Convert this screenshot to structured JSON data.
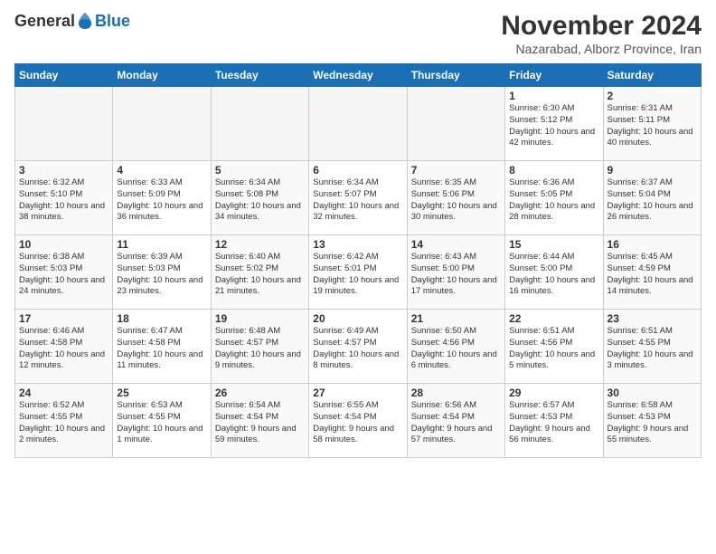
{
  "logo": {
    "general": "General",
    "blue": "Blue"
  },
  "header": {
    "month": "November 2024",
    "location": "Nazarabad, Alborz Province, Iran"
  },
  "weekdays": [
    "Sunday",
    "Monday",
    "Tuesday",
    "Wednesday",
    "Thursday",
    "Friday",
    "Saturday"
  ],
  "weeks": [
    [
      {
        "day": "",
        "detail": ""
      },
      {
        "day": "",
        "detail": ""
      },
      {
        "day": "",
        "detail": ""
      },
      {
        "day": "",
        "detail": ""
      },
      {
        "day": "",
        "detail": ""
      },
      {
        "day": "1",
        "detail": "Sunrise: 6:30 AM\nSunset: 5:12 PM\nDaylight: 10 hours\nand 42 minutes."
      },
      {
        "day": "2",
        "detail": "Sunrise: 6:31 AM\nSunset: 5:11 PM\nDaylight: 10 hours\nand 40 minutes."
      }
    ],
    [
      {
        "day": "3",
        "detail": "Sunrise: 6:32 AM\nSunset: 5:10 PM\nDaylight: 10 hours\nand 38 minutes."
      },
      {
        "day": "4",
        "detail": "Sunrise: 6:33 AM\nSunset: 5:09 PM\nDaylight: 10 hours\nand 36 minutes."
      },
      {
        "day": "5",
        "detail": "Sunrise: 6:34 AM\nSunset: 5:08 PM\nDaylight: 10 hours\nand 34 minutes."
      },
      {
        "day": "6",
        "detail": "Sunrise: 6:34 AM\nSunset: 5:07 PM\nDaylight: 10 hours\nand 32 minutes."
      },
      {
        "day": "7",
        "detail": "Sunrise: 6:35 AM\nSunset: 5:06 PM\nDaylight: 10 hours\nand 30 minutes."
      },
      {
        "day": "8",
        "detail": "Sunrise: 6:36 AM\nSunset: 5:05 PM\nDaylight: 10 hours\nand 28 minutes."
      },
      {
        "day": "9",
        "detail": "Sunrise: 6:37 AM\nSunset: 5:04 PM\nDaylight: 10 hours\nand 26 minutes."
      }
    ],
    [
      {
        "day": "10",
        "detail": "Sunrise: 6:38 AM\nSunset: 5:03 PM\nDaylight: 10 hours\nand 24 minutes."
      },
      {
        "day": "11",
        "detail": "Sunrise: 6:39 AM\nSunset: 5:03 PM\nDaylight: 10 hours\nand 23 minutes."
      },
      {
        "day": "12",
        "detail": "Sunrise: 6:40 AM\nSunset: 5:02 PM\nDaylight: 10 hours\nand 21 minutes."
      },
      {
        "day": "13",
        "detail": "Sunrise: 6:42 AM\nSunset: 5:01 PM\nDaylight: 10 hours\nand 19 minutes."
      },
      {
        "day": "14",
        "detail": "Sunrise: 6:43 AM\nSunset: 5:00 PM\nDaylight: 10 hours\nand 17 minutes."
      },
      {
        "day": "15",
        "detail": "Sunrise: 6:44 AM\nSunset: 5:00 PM\nDaylight: 10 hours\nand 16 minutes."
      },
      {
        "day": "16",
        "detail": "Sunrise: 6:45 AM\nSunset: 4:59 PM\nDaylight: 10 hours\nand 14 minutes."
      }
    ],
    [
      {
        "day": "17",
        "detail": "Sunrise: 6:46 AM\nSunset: 4:58 PM\nDaylight: 10 hours\nand 12 minutes."
      },
      {
        "day": "18",
        "detail": "Sunrise: 6:47 AM\nSunset: 4:58 PM\nDaylight: 10 hours\nand 11 minutes."
      },
      {
        "day": "19",
        "detail": "Sunrise: 6:48 AM\nSunset: 4:57 PM\nDaylight: 10 hours\nand 9 minutes."
      },
      {
        "day": "20",
        "detail": "Sunrise: 6:49 AM\nSunset: 4:57 PM\nDaylight: 10 hours\nand 8 minutes."
      },
      {
        "day": "21",
        "detail": "Sunrise: 6:50 AM\nSunset: 4:56 PM\nDaylight: 10 hours\nand 6 minutes."
      },
      {
        "day": "22",
        "detail": "Sunrise: 6:51 AM\nSunset: 4:56 PM\nDaylight: 10 hours\nand 5 minutes."
      },
      {
        "day": "23",
        "detail": "Sunrise: 6:51 AM\nSunset: 4:55 PM\nDaylight: 10 hours\nand 3 minutes."
      }
    ],
    [
      {
        "day": "24",
        "detail": "Sunrise: 6:52 AM\nSunset: 4:55 PM\nDaylight: 10 hours\nand 2 minutes."
      },
      {
        "day": "25",
        "detail": "Sunrise: 6:53 AM\nSunset: 4:55 PM\nDaylight: 10 hours\nand 1 minute."
      },
      {
        "day": "26",
        "detail": "Sunrise: 6:54 AM\nSunset: 4:54 PM\nDaylight: 9 hours\nand 59 minutes."
      },
      {
        "day": "27",
        "detail": "Sunrise: 6:55 AM\nSunset: 4:54 PM\nDaylight: 9 hours\nand 58 minutes."
      },
      {
        "day": "28",
        "detail": "Sunrise: 6:56 AM\nSunset: 4:54 PM\nDaylight: 9 hours\nand 57 minutes."
      },
      {
        "day": "29",
        "detail": "Sunrise: 6:57 AM\nSunset: 4:53 PM\nDaylight: 9 hours\nand 56 minutes."
      },
      {
        "day": "30",
        "detail": "Sunrise: 6:58 AM\nSunset: 4:53 PM\nDaylight: 9 hours\nand 55 minutes."
      }
    ]
  ]
}
